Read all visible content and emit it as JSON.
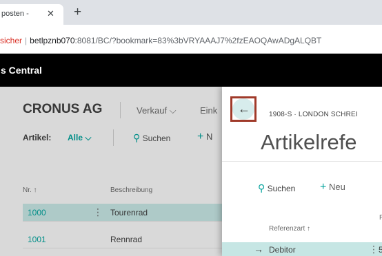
{
  "browser": {
    "tab_title": "posten - ",
    "tab_close": "✕",
    "new_tab": "+",
    "address": {
      "insecure_label": "sicher",
      "separator": "|",
      "host": "betlpznb070",
      "rest": ":8081/BC/?bookmark=83%3bVRYAAAJ7%2fzEAOQAwADgALQBT"
    }
  },
  "app": {
    "title": "s Central"
  },
  "background_page": {
    "company": "CRONUS AG",
    "nav": {
      "verkauf": "Verkauf",
      "verkauf_chevron": "⌵",
      "eink": "Eink"
    },
    "filter": {
      "label": "Artikel:",
      "value": "Alle",
      "chevron": "⌵"
    },
    "actions": {
      "search_icon": "⚲",
      "search_label": "Suchen",
      "new_plus": "+",
      "new_label": "N"
    },
    "columns": {
      "nr": "Nr. ↑",
      "desc": "Beschreibung"
    },
    "rows": [
      {
        "nr": "1000",
        "dots": "⋮",
        "desc": "Tourenrad"
      },
      {
        "nr": "1001",
        "dots": "",
        "desc": "Rennrad"
      }
    ]
  },
  "panel": {
    "back_arrow": "←",
    "breadcrumb": "1908-S · LONDON SCHREI",
    "title": "Artikelrefe",
    "actions": {
      "search_icon": "⚲",
      "search_label": "Suchen",
      "new_plus": "+",
      "new_label": "Neu"
    },
    "columns": {
      "referenzart": "Referenzart ↑",
      "second": "R"
    },
    "row": {
      "arrow": "→",
      "referenzart": "Debitor",
      "dots": "⋮",
      "second": "5"
    }
  },
  "colors": {
    "accent": "#00a29b",
    "selection": "#c6e6e4",
    "highlight_border": "#a03a2a",
    "appbar": "#000000"
  }
}
